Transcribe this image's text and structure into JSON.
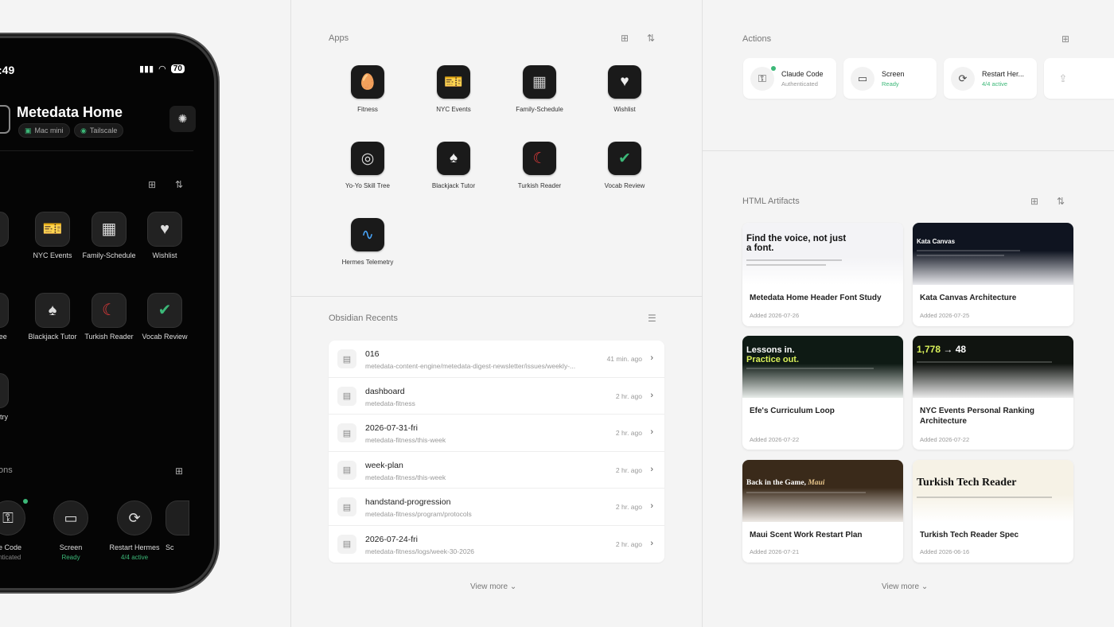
{
  "phone": {
    "time": ":49",
    "battery": "70",
    "title": "Metedata Home",
    "chips": [
      "Mac mini",
      "Tailscale"
    ],
    "apps": [
      {
        "label": "ness",
        "icon": "fitness-icon"
      },
      {
        "label": "NYC Events",
        "icon": "ticket-icon"
      },
      {
        "label": "Family-Schedule",
        "icon": "calendar-icon"
      },
      {
        "label": "Wishlist",
        "icon": "bookmark-heart-icon"
      },
      {
        "label": "o Skill ree",
        "icon": "yoyo-icon"
      },
      {
        "label": "Blackjack Tutor",
        "icon": "cards-icon"
      },
      {
        "label": "Turkish Reader",
        "icon": "flag-icon"
      },
      {
        "label": "Vocab Review",
        "icon": "checklist-icon"
      },
      {
        "label": "mes metry",
        "icon": "pulse-icon"
      }
    ],
    "actions_title": "ons",
    "actions": [
      {
        "label": "de Code",
        "sub": "enticated"
      },
      {
        "label": "Screen",
        "sub": "Ready"
      },
      {
        "label": "Restart Hermes",
        "sub": "4/4 active"
      },
      {
        "label": "Sc",
        "sub": ""
      }
    ]
  },
  "apps": {
    "title": "Apps",
    "items": [
      {
        "label": "Fitness",
        "icon": "fitness-icon"
      },
      {
        "label": "NYC Events",
        "icon": "ticket-icon"
      },
      {
        "label": "Family-Schedule",
        "icon": "calendar-icon"
      },
      {
        "label": "Wishlist",
        "icon": "bookmark-heart-icon"
      },
      {
        "label": "Yo-Yo Skill Tree",
        "icon": "yoyo-icon"
      },
      {
        "label": "Blackjack Tutor",
        "icon": "cards-icon"
      },
      {
        "label": "Turkish Reader",
        "icon": "flag-icon"
      },
      {
        "label": "Vocab Review",
        "icon": "checklist-icon"
      },
      {
        "label": "Hermes Telemetry",
        "icon": "pulse-icon"
      }
    ]
  },
  "obsidian": {
    "title": "Obsidian Recents",
    "view_more": "View more",
    "rows": [
      {
        "title": "016",
        "path": "metedata-content-engine/metedata-digest-newsletter/issues/weekly-...",
        "time": "41 min. ago"
      },
      {
        "title": "dashboard",
        "path": "metedata-fitness",
        "time": "2 hr. ago"
      },
      {
        "title": "2026-07-31-fri",
        "path": "metedata-fitness/this-week",
        "time": "2 hr. ago"
      },
      {
        "title": "week-plan",
        "path": "metedata-fitness/this-week",
        "time": "2 hr. ago"
      },
      {
        "title": "handstand-progression",
        "path": "metedata-fitness/program/protocols",
        "time": "2 hr. ago"
      },
      {
        "title": "2026-07-24-fri",
        "path": "metedata-fitness/logs/week-30-2026",
        "time": "2 hr. ago"
      }
    ]
  },
  "actions": {
    "title": "Actions",
    "items": [
      {
        "label": "Claude Code",
        "sub": "Authenticated"
      },
      {
        "label": "Screen",
        "sub": "Ready"
      },
      {
        "label": "Restart Her...",
        "sub": "4/4 active"
      }
    ]
  },
  "artifacts": {
    "title": "HTML Artifacts",
    "view_more": "View more",
    "cards": [
      {
        "title": "Metedata Home Header Font Study",
        "date": "Added 2026-07-26",
        "thumb_title": "Find the voice, not just a font."
      },
      {
        "title": "Kata Canvas Architecture",
        "date": "Added 2026-07-25",
        "thumb_title": "Kata Canvas"
      },
      {
        "title": "Efe's Curriculum Loop",
        "date": "Added 2026-07-22",
        "thumb_title": "Lessons in.",
        "thumb_title2": "Practice out."
      },
      {
        "title": "NYC Events Personal Ranking Architecture",
        "date": "Added 2026-07-22",
        "thumb_title": "1,778",
        "thumb_title2": "→ 48"
      },
      {
        "title": "Maui Scent Work Restart Plan",
        "date": "Added 2026-07-21",
        "thumb_title": "Back in the Game,",
        "thumb_title2": "Maui"
      },
      {
        "title": "Turkish Tech Reader Spec",
        "date": "Added 2026-06-16",
        "thumb_title": "Turkish Tech Reader"
      }
    ]
  },
  "colors": {
    "accent_green": "#3cb878",
    "phone_bg": "#050505",
    "page_bg": "#f4f4f4"
  }
}
